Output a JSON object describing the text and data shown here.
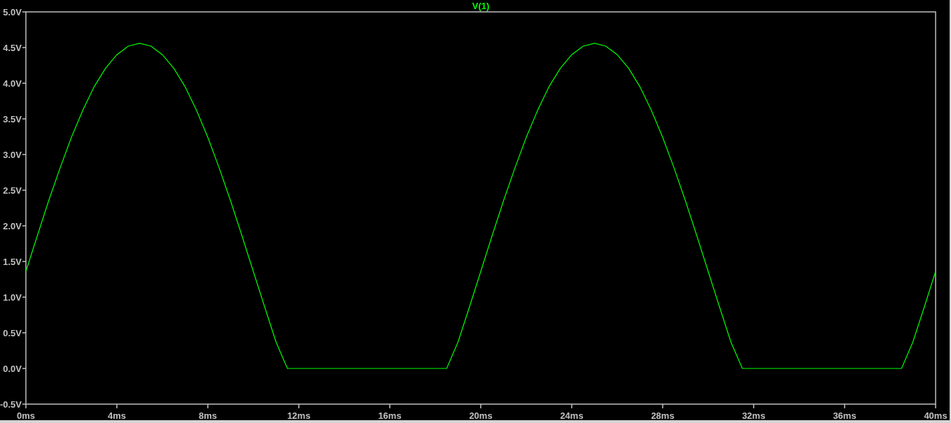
{
  "plot": {
    "chart_data": {
      "type": "line",
      "x": [
        0,
        0.5,
        1,
        1.5,
        2,
        2.5,
        3,
        3.5,
        4,
        4.5,
        5,
        5.5,
        6,
        6.5,
        7,
        7.5,
        8,
        8.5,
        9,
        9.5,
        10,
        10.5,
        11,
        11.5,
        12,
        12.5,
        13,
        13.5,
        14,
        14.5,
        15,
        15.5,
        16,
        16.5,
        17,
        17.5,
        18,
        18.5,
        19,
        19.5,
        20,
        20.5,
        21,
        21.5,
        22,
        22.5,
        23,
        23.5,
        24,
        24.5,
        25,
        25.5,
        26,
        26.5,
        27,
        27.5,
        28,
        28.5,
        29,
        29.5,
        30,
        30.5,
        31,
        31.5,
        32,
        32.5,
        33,
        33.5,
        34,
        34.5,
        35,
        35.5,
        36,
        36.5,
        37,
        37.5,
        38,
        38.5,
        39,
        39.5,
        40
      ],
      "series": [
        {
          "name": "V(1)",
          "color": "#00ff00",
          "values": [
            1.36,
            1.86,
            2.35,
            2.81,
            3.24,
            3.62,
            3.95,
            4.21,
            4.4,
            4.52,
            4.56,
            4.52,
            4.4,
            4.21,
            3.95,
            3.62,
            3.24,
            2.81,
            2.35,
            1.86,
            1.36,
            0.86,
            0.37,
            0,
            0,
            0,
            0,
            0,
            0,
            0,
            0,
            0,
            0,
            0,
            0,
            0,
            0,
            0,
            0.37,
            0.86,
            1.36,
            1.86,
            2.35,
            2.81,
            3.24,
            3.62,
            3.95,
            4.21,
            4.4,
            4.52,
            4.56,
            4.52,
            4.4,
            4.21,
            3.95,
            3.62,
            3.24,
            2.81,
            2.35,
            1.86,
            1.36,
            0.86,
            0.37,
            0,
            0,
            0,
            0,
            0,
            0,
            0,
            0,
            0,
            0,
            0,
            0,
            0,
            0,
            0,
            0.37,
            0.86,
            1.36
          ]
        }
      ],
      "xlim": [
        0,
        40
      ],
      "ylim": [
        -0.5,
        5
      ],
      "xticks": [
        {
          "value": 0,
          "label": "0ms"
        },
        {
          "value": 4,
          "label": "4ms"
        },
        {
          "value": 8,
          "label": "8ms"
        },
        {
          "value": 12,
          "label": "12ms"
        },
        {
          "value": 16,
          "label": "16ms"
        },
        {
          "value": 20,
          "label": "20ms"
        },
        {
          "value": 24,
          "label": "24ms"
        },
        {
          "value": 28,
          "label": "28ms"
        },
        {
          "value": 32,
          "label": "32ms"
        },
        {
          "value": 36,
          "label": "36ms"
        },
        {
          "value": 40,
          "label": "40ms"
        }
      ],
      "yticks": [
        {
          "value": -0.5,
          "label": "-0.5V"
        },
        {
          "value": 0,
          "label": "0.0V"
        },
        {
          "value": 0.5,
          "label": "0.5V"
        },
        {
          "value": 1,
          "label": "1.0V"
        },
        {
          "value": 1.5,
          "label": "1.5V"
        },
        {
          "value": 2,
          "label": "2.0V"
        },
        {
          "value": 2.5,
          "label": "2.5V"
        },
        {
          "value": 3,
          "label": "3.0V"
        },
        {
          "value": 3.5,
          "label": "3.5V"
        },
        {
          "value": 4,
          "label": "4.0V"
        },
        {
          "value": 4.5,
          "label": "4.5V"
        },
        {
          "value": 5,
          "label": "5.0V"
        }
      ]
    }
  }
}
